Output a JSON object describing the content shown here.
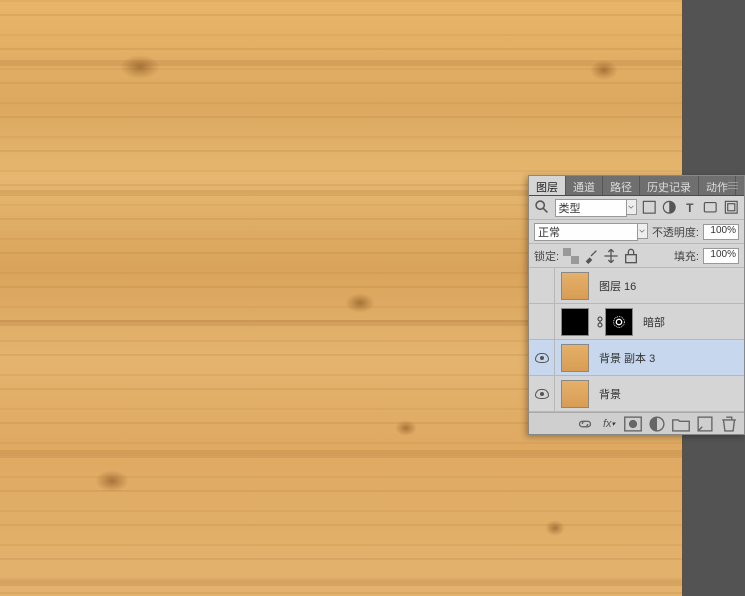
{
  "tabs": [
    "图层",
    "通道",
    "路径",
    "历史记录",
    "动作"
  ],
  "active_tab": "图层",
  "filter": {
    "kind_label": "类型",
    "search_icon": "search-icon"
  },
  "blend": {
    "mode": "正常",
    "opacity_label": "不透明度:",
    "opacity": "100%",
    "fill_label": "填充:",
    "fill": "100%",
    "lock_label": "锁定:"
  },
  "layers": [
    {
      "visible": false,
      "thumb": "wood",
      "name": "图层 16",
      "selected": false,
      "mask": null
    },
    {
      "visible": false,
      "thumb": "black",
      "name": "暗部",
      "selected": false,
      "mask": "ring"
    },
    {
      "visible": true,
      "thumb": "wood",
      "name": "背景 副本 3",
      "selected": true,
      "mask": null
    },
    {
      "visible": true,
      "thumb": "wood",
      "name": "背景",
      "selected": false,
      "mask": null
    }
  ],
  "bottom_icons": [
    "link",
    "fx",
    "mask",
    "adjust",
    "group",
    "new",
    "trash"
  ]
}
